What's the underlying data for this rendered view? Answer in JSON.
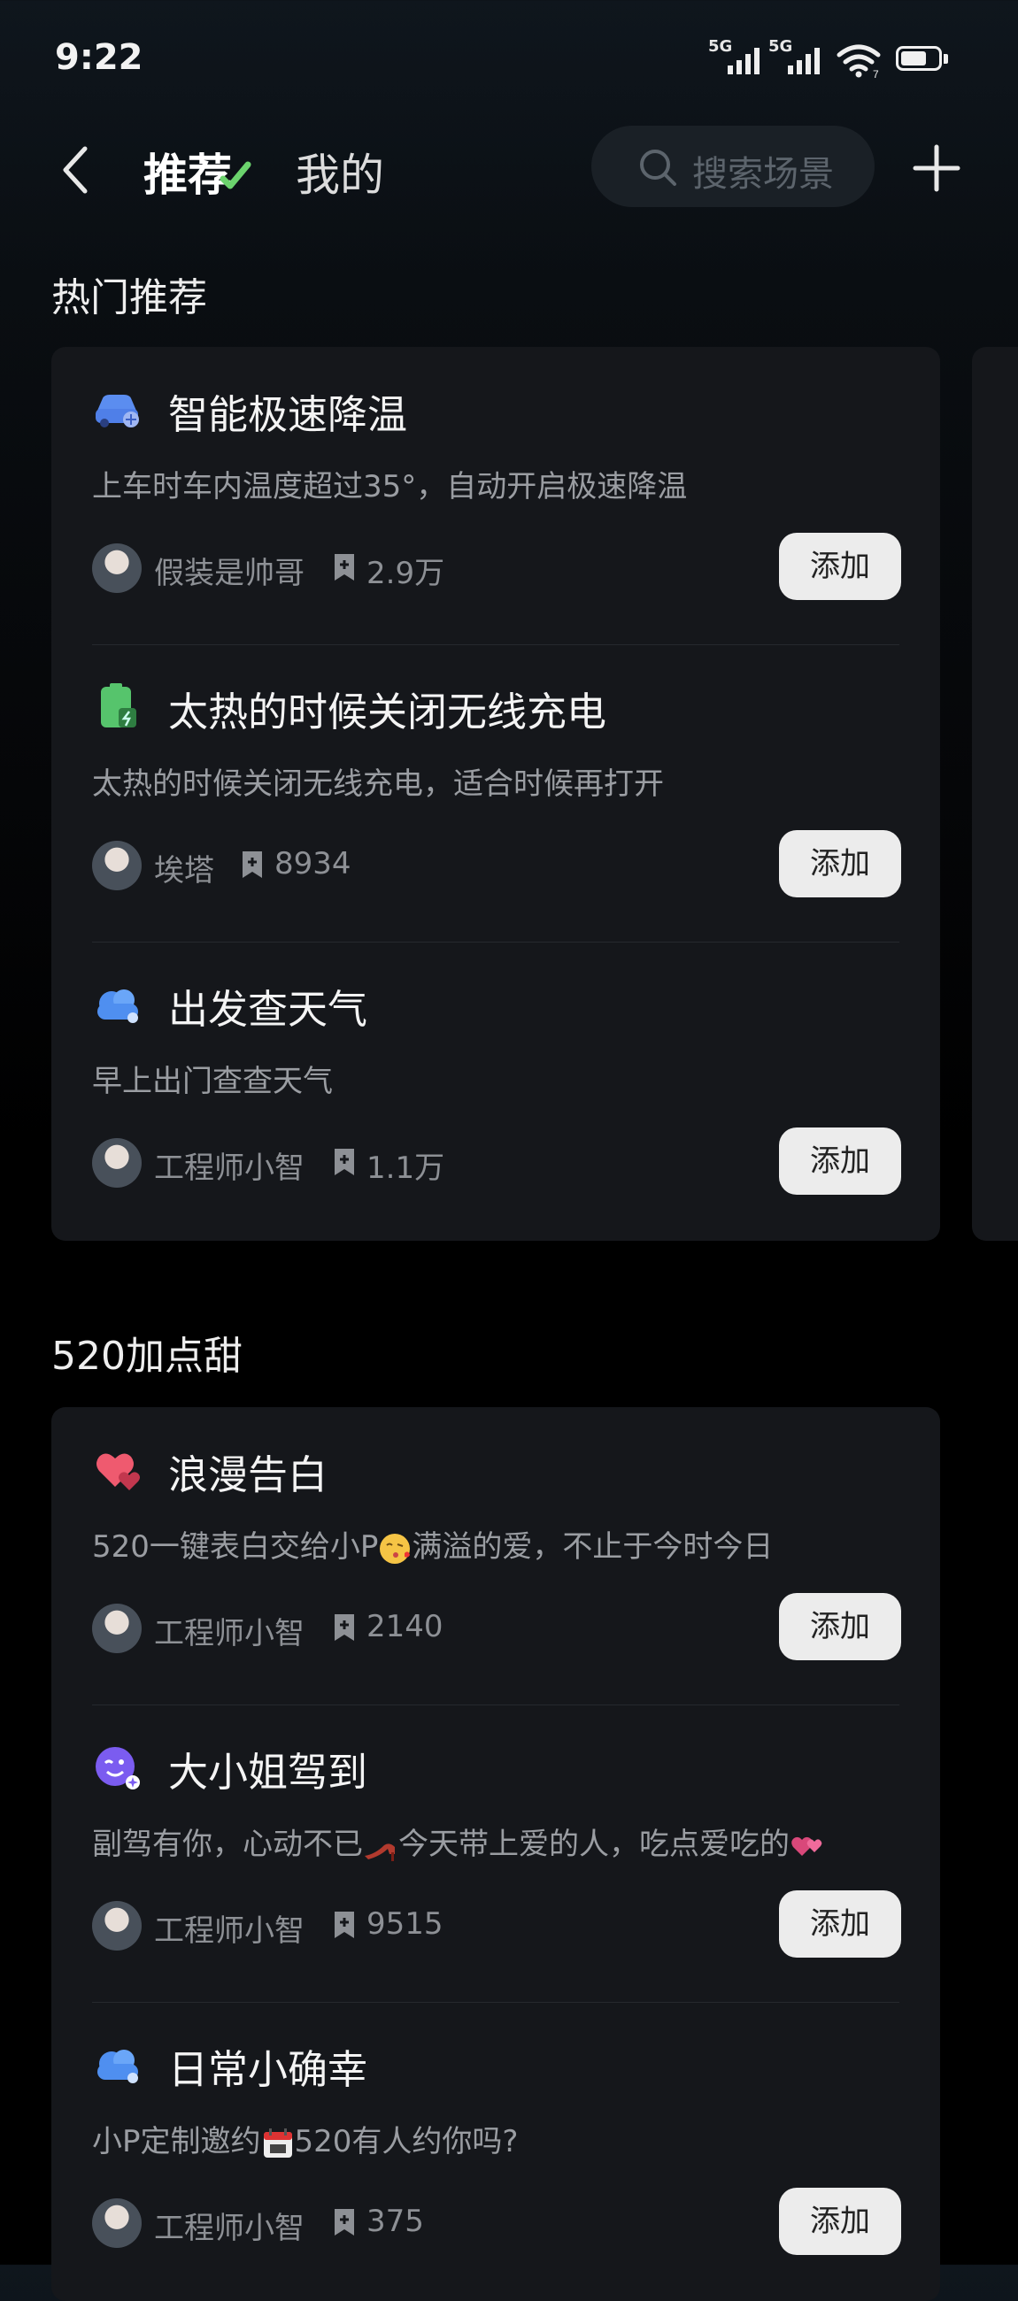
{
  "status_bar": {
    "time": "9:22",
    "sim1": "5G",
    "sim2": "5G",
    "wifi_badge": "7"
  },
  "nav": {
    "tab_recommend": "推荐",
    "tab_mine": "我的",
    "search_placeholder": "搜索场景",
    "icons": [
      "back-icon",
      "check-icon",
      "search-icon",
      "plus-icon"
    ]
  },
  "sections": [
    {
      "title": "热门推荐",
      "items": [
        {
          "icon": "car-icon",
          "title": "智能极速降温",
          "desc": "上车时车内温度超过35°，自动开启极速降温",
          "author": "假装是帅哥",
          "saves": "2.9万",
          "button": "添加"
        },
        {
          "icon": "battery-charge-icon",
          "title": "太热的时候关闭无线充电",
          "desc": "太热的时候关闭无线充电，适合时候再打开",
          "author": "埃塔",
          "saves": "8934",
          "button": "添加"
        },
        {
          "icon": "cloud-icon",
          "title": "出发查天气",
          "desc": "早上出门查查天气",
          "author": "工程师小智",
          "saves": "1.1万",
          "button": "添加"
        }
      ]
    },
    {
      "title": "520加点甜",
      "items": [
        {
          "icon": "hearts-icon",
          "title": "浪漫告白",
          "desc_a": "520一键表白交给小P",
          "desc_b": "满溢的爱，不止于今时今日",
          "author": "工程师小智",
          "saves": "2140",
          "button": "添加"
        },
        {
          "icon": "wink-face-icon",
          "title": "大小姐驾到",
          "desc_a": "副驾有你，心动不已",
          "desc_b": "今天带上爱的人，吃点爱吃的",
          "author": "工程师小智",
          "saves": "9515",
          "button": "添加"
        },
        {
          "icon": "cloud-icon",
          "title": "日常小确幸",
          "desc_a": "小P定制邀约",
          "desc_b": "520有人约你吗?",
          "author": "工程师小智",
          "saves": "375",
          "button": "添加"
        }
      ]
    }
  ],
  "colors": {
    "background": "#000000",
    "card": "#15171b",
    "accent_green": "#5fd46a",
    "button_bg": "#ececec"
  }
}
